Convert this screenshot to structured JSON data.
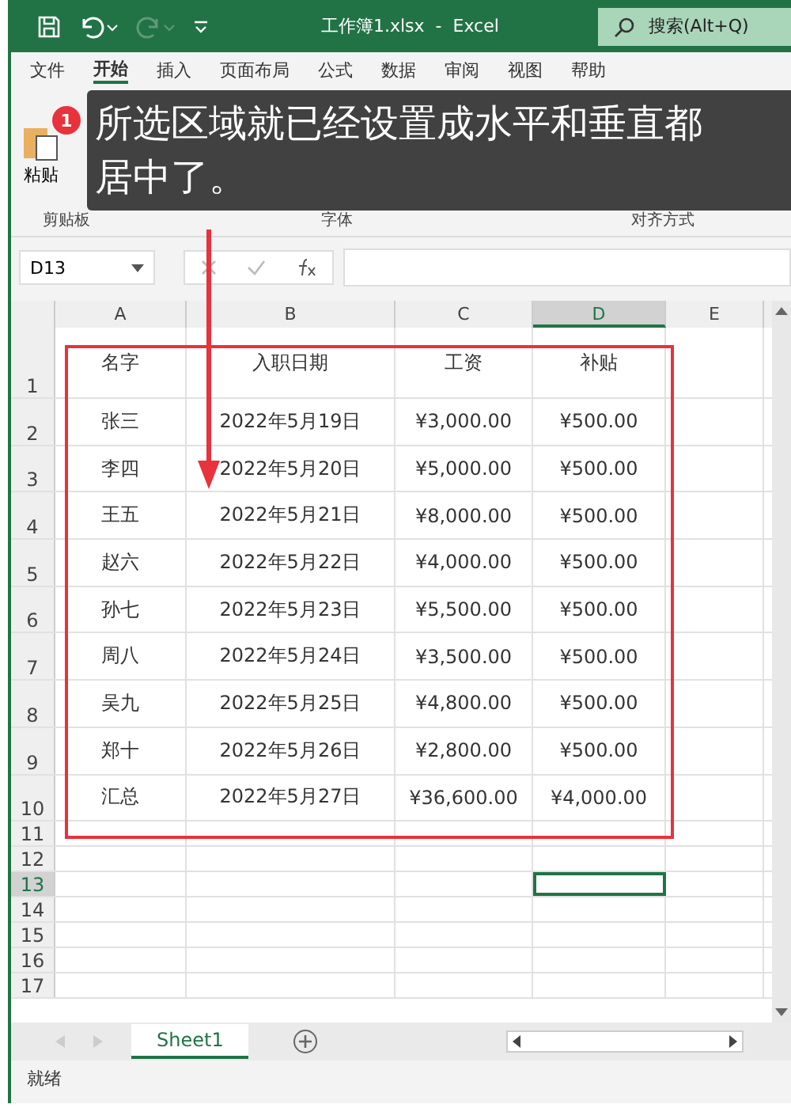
{
  "title_bar": {
    "title": "工作簿1.xlsx  -  Excel",
    "search_placeholder": "搜索(Alt+Q)"
  },
  "ribbon_tabs": [
    {
      "label": "文件",
      "selected": false
    },
    {
      "label": "开始",
      "selected": true
    },
    {
      "label": "插入",
      "selected": false
    },
    {
      "label": "页面布局",
      "selected": false
    },
    {
      "label": "公式",
      "selected": false
    },
    {
      "label": "数据",
      "selected": false
    },
    {
      "label": "审阅",
      "selected": false
    },
    {
      "label": "视图",
      "selected": false
    },
    {
      "label": "帮助",
      "selected": false
    }
  ],
  "ribbon": {
    "paste_label": "粘贴",
    "groups": [
      "剪贴板",
      "字体",
      "对齐方式"
    ]
  },
  "callout": {
    "badge": "1",
    "text": "所选区域就已经设置成水平和垂直都居中了。"
  },
  "formula_bar": {
    "name_box": "D13"
  },
  "sheet": {
    "columns": [
      {
        "label": "A",
        "selected": false
      },
      {
        "label": "B",
        "selected": false
      },
      {
        "label": "C",
        "selected": false
      },
      {
        "label": "D",
        "selected": true
      },
      {
        "label": "E",
        "selected": false
      }
    ],
    "rows": [
      {
        "number": "1",
        "cells": [
          "名字",
          "入职日期",
          "工资",
          "补贴"
        ]
      },
      {
        "number": "2",
        "cells": [
          "张三",
          "2022年5月19日",
          "¥3,000.00",
          "¥500.00"
        ]
      },
      {
        "number": "3",
        "cells": [
          "李四",
          "2022年5月20日",
          "¥5,000.00",
          "¥500.00"
        ]
      },
      {
        "number": "4",
        "cells": [
          "王五",
          "2022年5月21日",
          "¥8,000.00",
          "¥500.00"
        ]
      },
      {
        "number": "5",
        "cells": [
          "赵六",
          "2022年5月22日",
          "¥4,000.00",
          "¥500.00"
        ]
      },
      {
        "number": "6",
        "cells": [
          "孙七",
          "2022年5月23日",
          "¥5,500.00",
          "¥500.00"
        ]
      },
      {
        "number": "7",
        "cells": [
          "周八",
          "2022年5月24日",
          "¥3,500.00",
          "¥500.00"
        ]
      },
      {
        "number": "8",
        "cells": [
          "吴九",
          "2022年5月25日",
          "¥4,800.00",
          "¥500.00"
        ]
      },
      {
        "number": "9",
        "cells": [
          "郑十",
          "2022年5月26日",
          "¥2,800.00",
          "¥500.00"
        ]
      },
      {
        "number": "10",
        "cells": [
          "汇总",
          "2022年5月27日",
          "¥36,600.00",
          "¥4,000.00"
        ]
      }
    ],
    "blank_rows": [
      {
        "number": "11",
        "selected": false
      },
      {
        "number": "12",
        "selected": false
      },
      {
        "number": "13",
        "selected": true
      },
      {
        "number": "14",
        "selected": false
      },
      {
        "number": "15",
        "selected": false
      },
      {
        "number": "16",
        "selected": false
      },
      {
        "number": "17",
        "selected": false
      }
    ]
  },
  "sheet_tabs": [
    {
      "label": "Sheet1",
      "selected": true
    }
  ],
  "status_bar": {
    "text": "就绪"
  }
}
